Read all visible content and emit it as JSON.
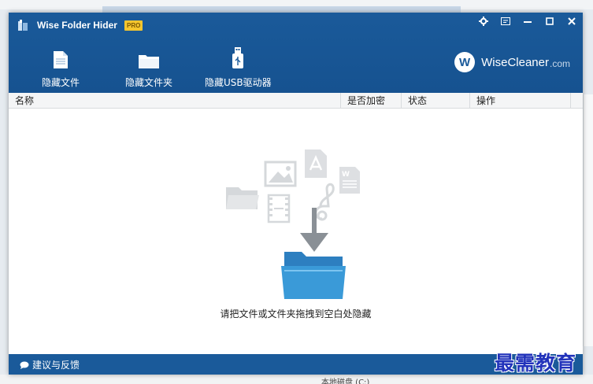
{
  "window": {
    "title": "Wise Folder Hider",
    "badge": "PRO"
  },
  "toolbar": {
    "hide_file": "隐藏文件",
    "hide_folder": "隐藏文件夹",
    "hide_usb": "隐藏USB驱动器"
  },
  "brand": {
    "logo_letter": "W",
    "name": "WiseCleaner",
    "suffix": ".com"
  },
  "table": {
    "columns": [
      "名称",
      "是否加密",
      "状态",
      "操作"
    ]
  },
  "content": {
    "drop_hint": "请把文件或文件夹拖拽到空白处隐藏"
  },
  "footer": {
    "feedback": "建议与反馈"
  },
  "background": {
    "taskbar_text": "本地磁盘 (C:)"
  },
  "watermark": {
    "text": "最需教育"
  },
  "icons": [
    "app-icon",
    "settings-icon",
    "skin-icon",
    "minimize-icon",
    "maximize-icon",
    "close-icon",
    "file-icon",
    "folder-icon",
    "usb-icon",
    "feedback-bubble-icon"
  ],
  "colors": {
    "header_bg": "#1a5a9a",
    "badge_bg": "#f5c62e",
    "folder_blue": "#3a9ad8"
  }
}
